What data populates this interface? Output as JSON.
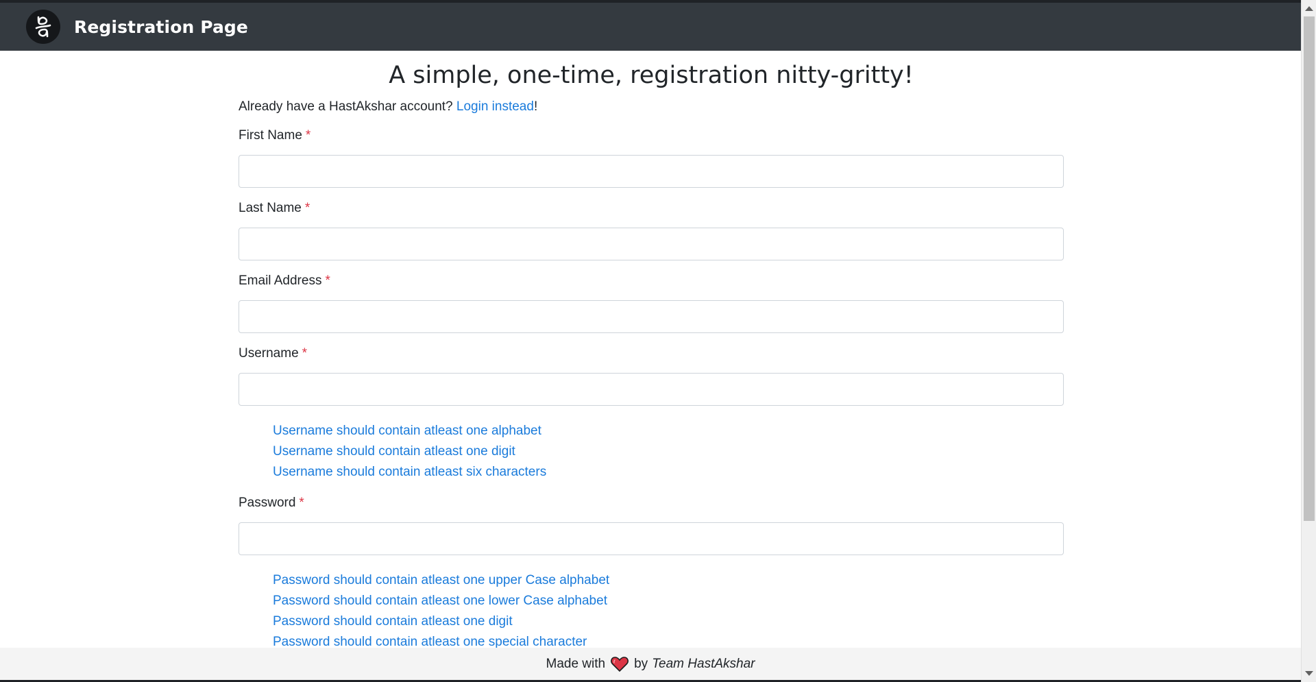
{
  "navbar": {
    "logo_icon": "hastakshar-logo-icon",
    "title": "Registration Page"
  },
  "main": {
    "heading": "A simple, one-time, registration nitty-gritty!",
    "already_text": "Already have a HastAkshar account? ",
    "login_link": "Login instead",
    "already_suffix": "!"
  },
  "form": {
    "required_marker": "*",
    "first_name": {
      "label": "First Name",
      "value": ""
    },
    "last_name": {
      "label": "Last Name",
      "value": ""
    },
    "email": {
      "label": "Email Address",
      "value": ""
    },
    "username": {
      "label": "Username",
      "value": ""
    },
    "username_hints": [
      "Username should contain atleast one alphabet",
      "Username should contain atleast one digit",
      "Username should contain atleast six characters"
    ],
    "password": {
      "label": "Password",
      "value": ""
    },
    "password_hints": [
      "Password should contain atleast one upper Case alphabet",
      "Password should contain atleast one lower Case alphabet",
      "Password should contain atleast one digit",
      "Password should contain atleast one special character"
    ]
  },
  "footer": {
    "made_with": "Made with",
    "heart_icon": "heart-icon",
    "by": "by",
    "team": "Team HastAkshar"
  },
  "colors": {
    "navbar_bg": "#343a40",
    "link": "#1a7bdb",
    "required": "#dc3545",
    "footer_bg": "#f4f4f4",
    "heart": "#dc3545"
  }
}
